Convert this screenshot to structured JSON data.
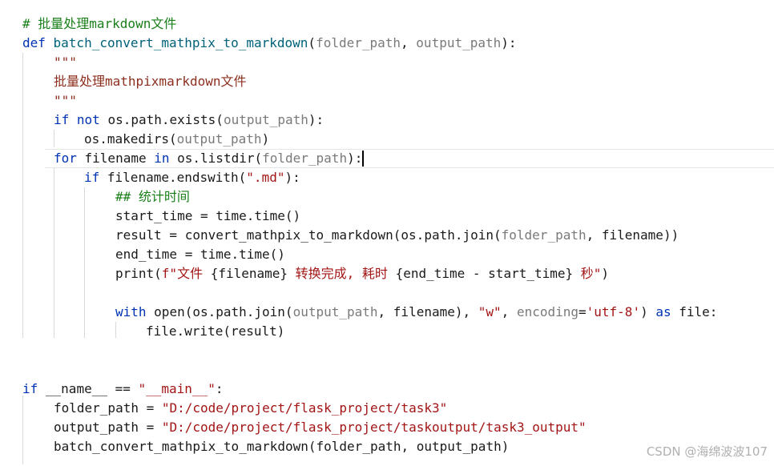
{
  "editor": {
    "language": "python",
    "lines": [
      [
        {
          "t": "# 批量处理markdown文件",
          "c": "cmt"
        }
      ],
      [
        {
          "t": "def ",
          "c": "kw"
        },
        {
          "t": "batch_convert_mathpix_to_markdown",
          "c": "fn"
        },
        {
          "t": "("
        },
        {
          "t": "folder_path",
          "c": "param"
        },
        {
          "t": ", "
        },
        {
          "t": "output_path",
          "c": "param"
        },
        {
          "t": "):"
        }
      ],
      [
        {
          "t": "\"\"\"",
          "c": "docstr"
        }
      ],
      [
        {
          "t": "批量处理mathpixmarkdown文件",
          "c": "docstr"
        }
      ],
      [
        {
          "t": "\"\"\"",
          "c": "docstr"
        }
      ],
      [
        {
          "t": "if not ",
          "c": "kw"
        },
        {
          "t": "os.path.exists("
        },
        {
          "t": "output_path",
          "c": "param"
        },
        {
          "t": "):"
        }
      ],
      [
        {
          "t": "os.makedirs("
        },
        {
          "t": "output_path",
          "c": "param"
        },
        {
          "t": ")"
        }
      ],
      [
        {
          "t": "for ",
          "c": "kw"
        },
        {
          "t": "filename "
        },
        {
          "t": "in ",
          "c": "kw"
        },
        {
          "t": "os.listdir("
        },
        {
          "t": "folder_path",
          "c": "param"
        },
        {
          "t": "):"
        }
      ],
      [
        {
          "t": "if ",
          "c": "kw"
        },
        {
          "t": "filename.endswith("
        },
        {
          "t": "\".md\"",
          "c": "str"
        },
        {
          "t": "):"
        }
      ],
      [
        {
          "t": "## 统计时间",
          "c": "cmt"
        }
      ],
      [
        {
          "t": "start_time = time.time()"
        }
      ],
      [
        {
          "t": "result = convert_mathpix_to_markdown(os.path.join("
        },
        {
          "t": "folder_path",
          "c": "param"
        },
        {
          "t": ", filename))"
        }
      ],
      [
        {
          "t": "end_time = time.time()"
        }
      ],
      [
        {
          "t": "print("
        },
        {
          "t": "f\"文件 ",
          "c": "str"
        },
        {
          "t": "{filename}"
        },
        {
          "t": " 转换完成, 耗时 ",
          "c": "str"
        },
        {
          "t": "{end_time - start_time}"
        },
        {
          "t": " 秒\"",
          "c": "str"
        },
        {
          "t": ")"
        }
      ],
      [],
      [
        {
          "t": "with ",
          "c": "kw"
        },
        {
          "t": "open(os.path.join("
        },
        {
          "t": "output_path",
          "c": "param"
        },
        {
          "t": ", filename), "
        },
        {
          "t": "\"w\"",
          "c": "str"
        },
        {
          "t": ", "
        },
        {
          "t": "encoding",
          "c": "kwarg"
        },
        {
          "t": "="
        },
        {
          "t": "'utf-8'",
          "c": "str"
        },
        {
          "t": ") "
        },
        {
          "t": "as ",
          "c": "kw"
        },
        {
          "t": "file:"
        }
      ],
      [
        {
          "t": "file.write(result)"
        }
      ],
      [],
      [],
      [
        {
          "t": "if ",
          "c": "kw"
        },
        {
          "t": "__name__ == "
        },
        {
          "t": "\"__main__\"",
          "c": "str"
        },
        {
          "t": ":"
        }
      ],
      [
        {
          "t": "folder_path = "
        },
        {
          "t": "\"D:/code/project/flask_project/task3\"",
          "c": "str"
        }
      ],
      [
        {
          "t": "output_path = "
        },
        {
          "t": "\"D:/code/project/flask_project/taskoutput/task3_output\"",
          "c": "str"
        }
      ],
      [
        {
          "t": "batch_convert_mathpix_to_markdown(folder_path, output_path)"
        }
      ]
    ]
  },
  "watermark": "CSDN @海绵波波107"
}
